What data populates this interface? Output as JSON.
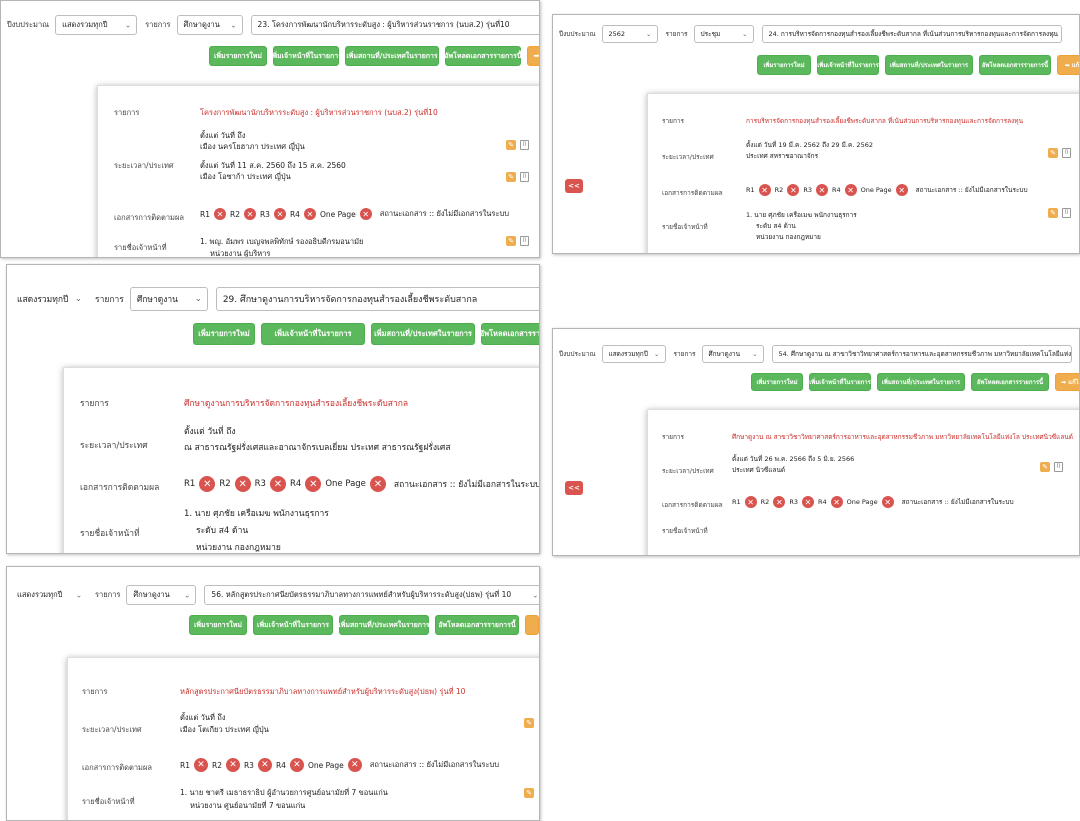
{
  "common": {
    "year_label": "ปีงบประมาณ",
    "item_type_label": "รายการ",
    "btn_add_item": "เพิ่มรายการใหม่",
    "btn_add_staff": "เพิ่มเจ้าหน้าที่ในรายการ",
    "btn_add_place": "เพิ่มสถานที่/ประเทศในรายการ",
    "btn_upload": "อัพโหลดเอกสารรายการนี้",
    "lbl_item": "รายการ",
    "lbl_period": "ระยะเวลา/ประเทศ",
    "lbl_docs": "เอกสารการติดตามผล",
    "lbl_staff": "รายชื่อเจ้าหน้าที่",
    "badges": [
      "R1",
      "R2",
      "R3",
      "R4",
      "One Page"
    ],
    "doc_status": "สถานะเอกสาร :: ยังไม่มีเอกสารในระบบ",
    "back": "<<",
    "orange_btn_partial": "➡ แก้",
    "orange_btn_partial2": "➡ แก้ไ"
  },
  "p1": {
    "year": "แสดงรวมทุกปี",
    "type": "ศึกษาดูงาน",
    "item": "23. โครงการพัฒนานักบริหารระดับสูง : ผู้บริหารส่วนราชการ (นบส.2) รุ่นที่10",
    "title": "โครงการพัฒนานักบริหารระดับสูง : ผู้บริหารส่วนราชการ (นบส.2) รุ่นที่10",
    "period1": "ตั้งแต่ วันที่ ถึง",
    "place1": "เมือง นครโยฮาภา ประเทศ ญี่ปุ่น",
    "period2": "ตั้งแต่ วันที่ 11 ส.ค. 2560 ถึง 15 ส.ค. 2560",
    "place2": "เมือง โอซาก้า ประเทศ ญี่ปุ่น",
    "staff1": "1. พญ. อัมพร เบญจพลพิทักษ์ รองอธิบดีกรมอนามัย",
    "staff2": "หน่วยงาน ผู้บริหาร"
  },
  "p2": {
    "type": "ประชุม",
    "year": "2562",
    "item": "24. การบริหารจัดการกองทุนสำรองเลี้ยงชีพระดับสากล ที่เน้นส่วนการบริหารกองทุนและการจัดการลงทุน",
    "title": "การบริหารจัดการกองทุนสำรองเลี้ยงชีพระดับสากล ที่เน้นส่วนการบริหารกองทุนและการจัดการลงทุน",
    "period1": "ตั้งแต่ วันที่ 19 มี.ค. 2562 ถึง 29 มี.ค. 2562",
    "place1": "ประเทศ สหราชอาณาจักร",
    "staff1": "1. นาย ศุภชัย เครือเมฆ พนักงานธุรการ",
    "staff2": "ระดับ ส4 ด้าน",
    "staff3": "หน่วยงาน กองกฎหมาย"
  },
  "p3": {
    "year": "แสดงรวมทุกปี",
    "type": "ศึกษาดูงาน",
    "item": "29. ศึกษาดูงานการบริหารจัดการกองทุนสำรองเลี้ยงชีพระดับสากล",
    "title": "ศึกษาดูงานการบริหารจัดการกองทุนสำรองเลี้ยงชีพระดับสากล",
    "period1": "ตั้งแต่ วันที่ ถึง",
    "place1": "ณ สาธารณรัฐฝรั่งเศสและอาณาจักรเบลเยี่ยม ประเทศ สาธารณรัฐฝรั่งเศส",
    "staff1": "1. นาย ศุภชัย เครือเมฆ พนักงานธุรการ",
    "staff2": "ระดับ ส4 ด้าน",
    "staff3": "หน่วยงาน กองกฎหมาย"
  },
  "p4": {
    "year": "แสดงรวมทุกปี",
    "type": "ศึกษาดูงาน",
    "item": "54. ศึกษาดูงาน ณ สาขาวิชาวิทยาศาสตร์การอาหารและอุตสาหกรรมชีวภาพ มหาวิทยาลัยเทคโนโลยีแห่งโล",
    "title": "ศึกษาดูงาน ณ สาขาวิชาวิทยาศาสตร์การอาหารและอุตสาหกรรมชีวภาพ มหาวิทยาลัยเทคโนโลยีแห่งโล ประเทศนิวซีแลนด์",
    "period1": "ตั้งแต่ วันที่ 26 พ.ค. 2566 ถึง 5 มิ.ย. 2566",
    "place1": "ประเทศ นิวซีแลนด์"
  },
  "p5": {
    "year": "แสดงรวมทุกปี",
    "type": "ศึกษาดูงาน",
    "item": "56. หลักสูตรประกาศนียบัตรธรรมาภิบาลทางการแพทย์สำหรับผู้บริหารระดับสูง(ปธพ) รุ่นที่ 10",
    "title": "หลักสูตรประกาศนียบัตรธรรมาภิบาลทางการแพทย์สำหรับผู้บริหารระดับสูง(ปธพ) รุ่นที่ 10",
    "period1": "ตั้งแต่ วันที่ ถึง",
    "place1": "เมือง โตเกียว ประเทศ ญี่ปุ่น",
    "staff1": "1. นาย ชาตรี เมธาธราธิป ผู้อำนวยการศูนย์อนามัยที่ 7 ขอนแก่น",
    "staff2": "หน่วยงาน ศูนย์อนามัยที่ 7 ขอนแก่น"
  }
}
